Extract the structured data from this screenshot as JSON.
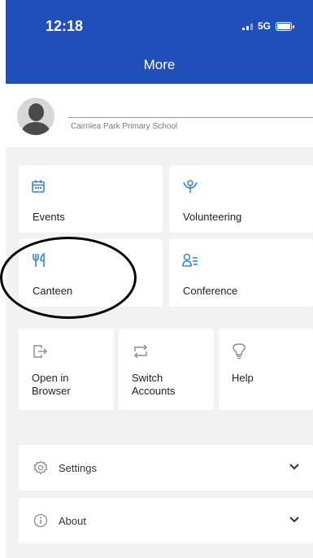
{
  "status_bar": {
    "time": "12:18",
    "network": "5G"
  },
  "header": {
    "title": "More"
  },
  "profile": {
    "school": "Cairnlea Park Primary School"
  },
  "tiles_large": [
    {
      "label": "Events",
      "icon": "calendar-icon"
    },
    {
      "label": "Volunteering",
      "icon": "volunteer-icon"
    },
    {
      "label": "Canteen",
      "icon": "fork-knife-icon"
    },
    {
      "label": "Conference",
      "icon": "conference-icon"
    }
  ],
  "tiles_small": [
    {
      "label": "Open in\nBrowser",
      "icon": "open-browser-icon"
    },
    {
      "label": "Switch\nAccounts",
      "icon": "switch-icon"
    },
    {
      "label": "Help",
      "icon": "lightbulb-icon"
    }
  ],
  "list": [
    {
      "label": "Settings",
      "icon": "gear-icon"
    },
    {
      "label": "About",
      "icon": "info-icon"
    }
  ],
  "colors": {
    "header": "#1f4fb8",
    "accent": "#3a86d8",
    "background": "#f2f2f2"
  }
}
